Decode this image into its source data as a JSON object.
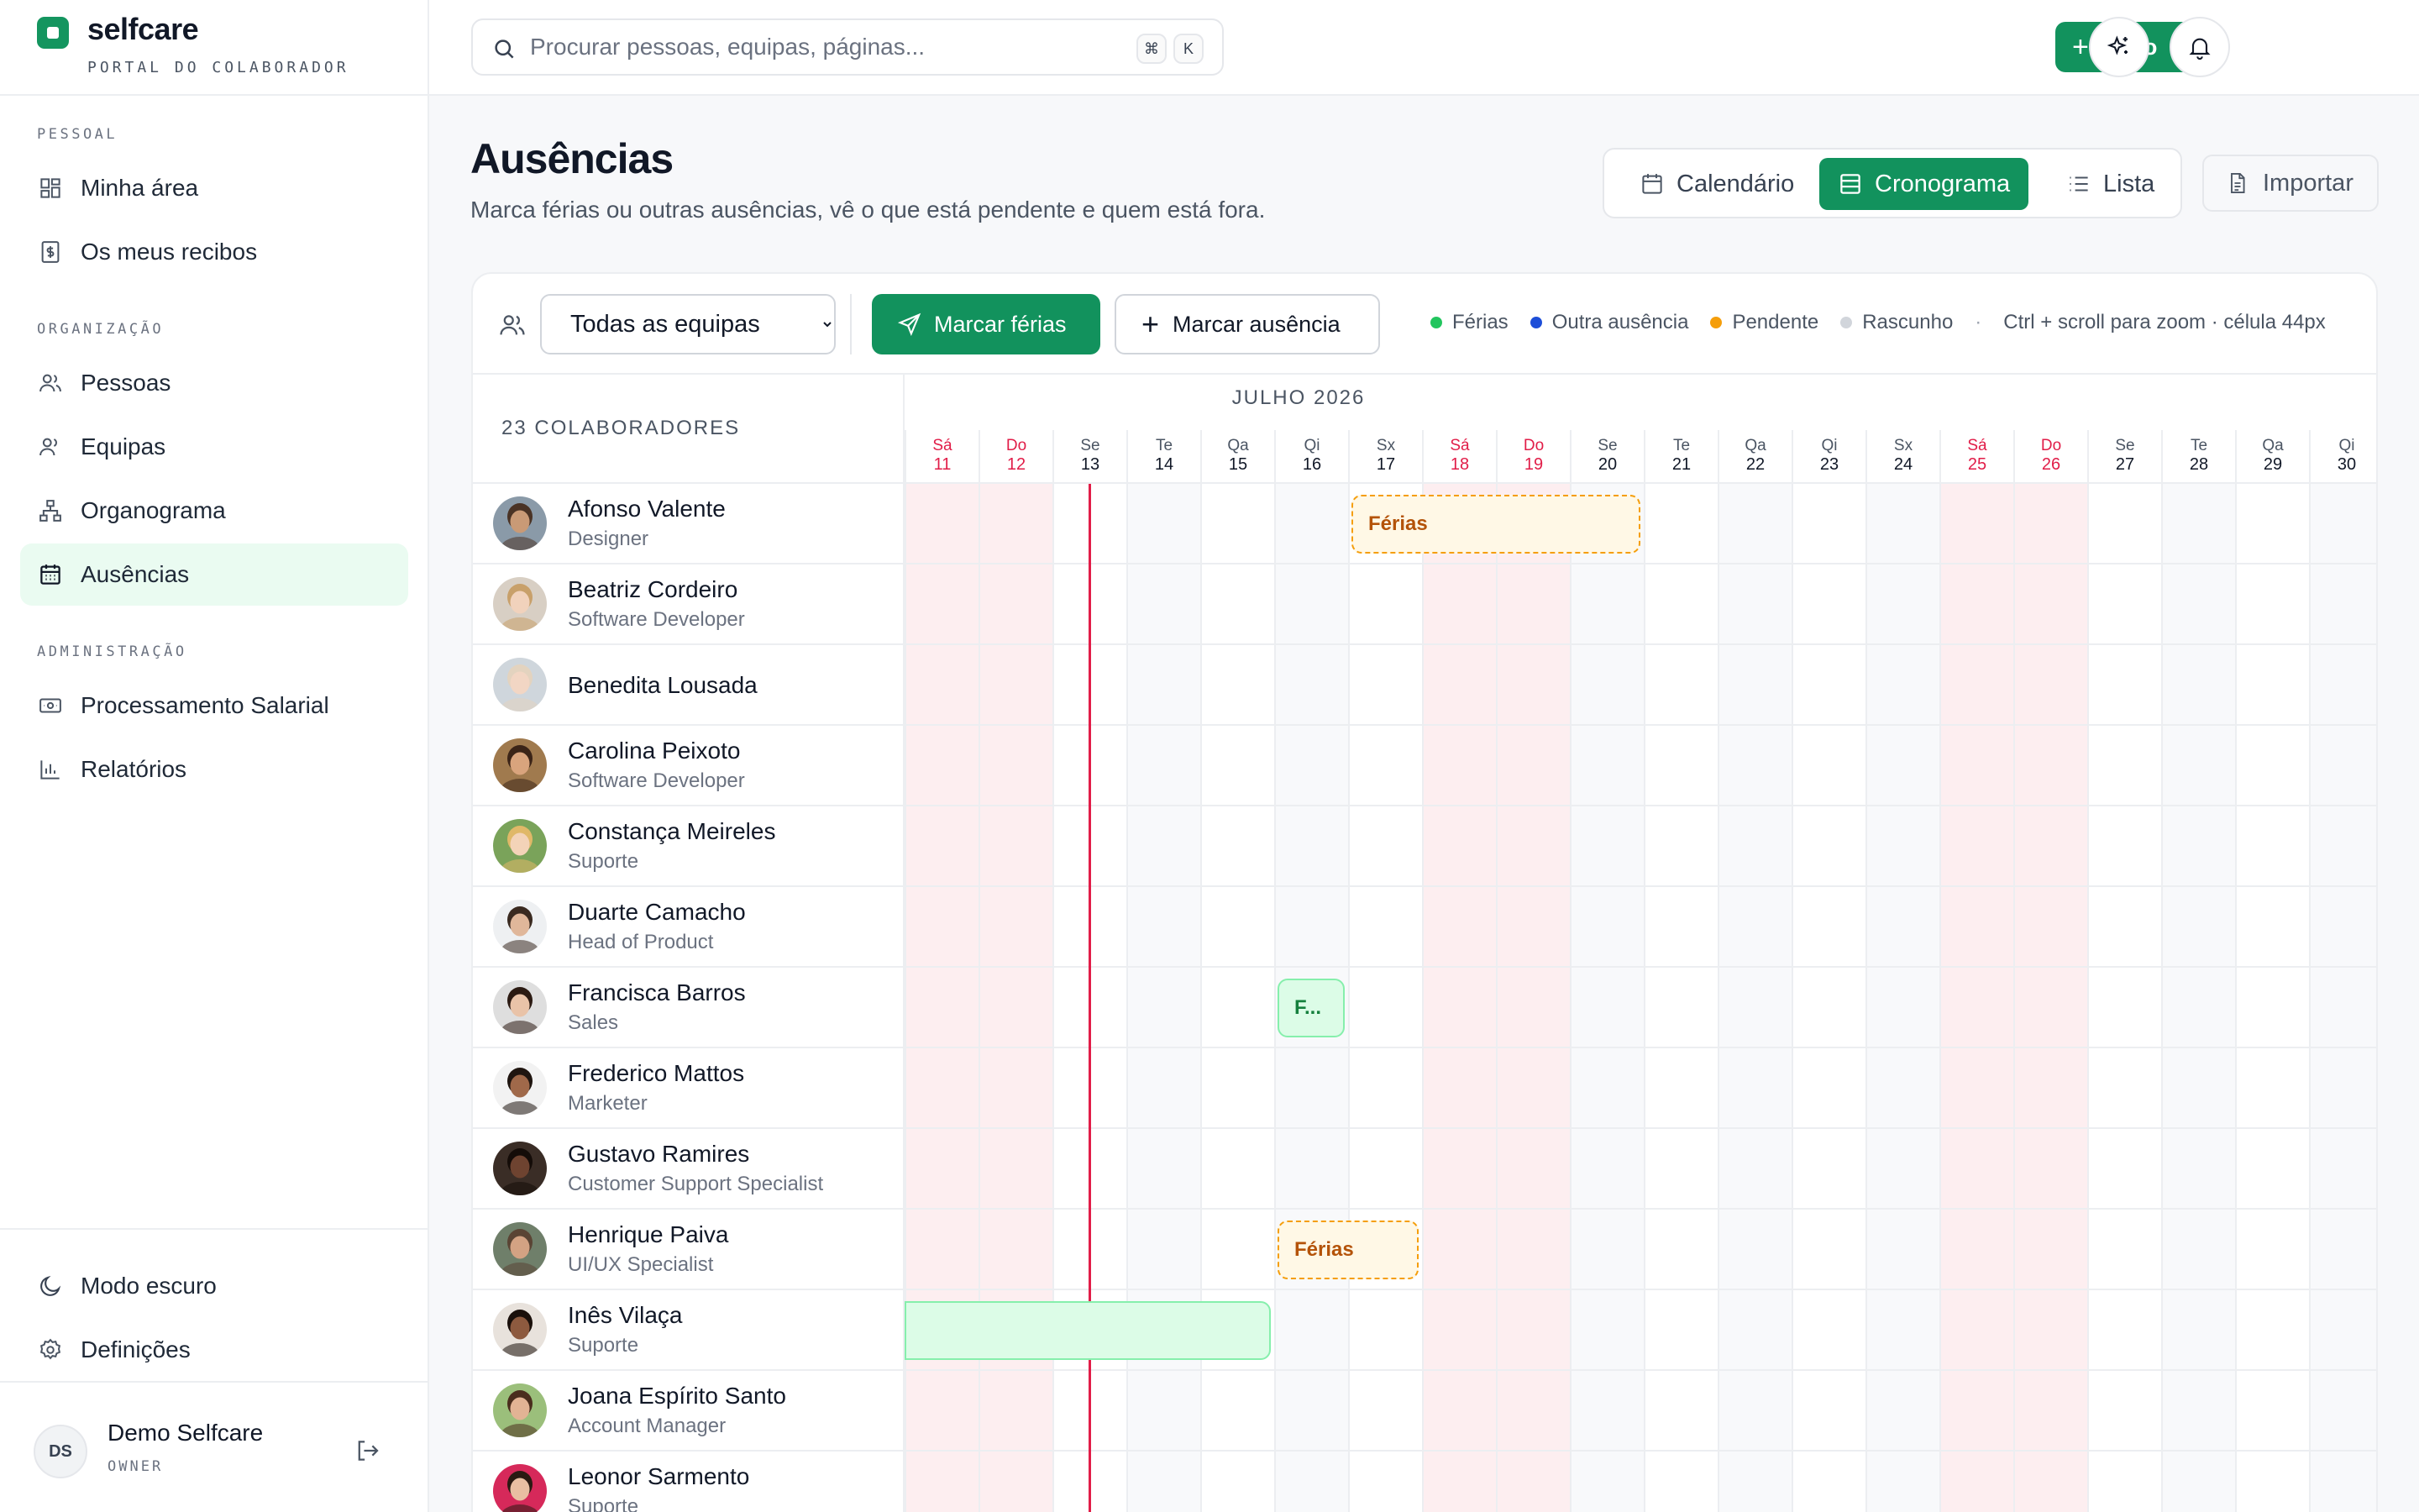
{
  "brand": {
    "name": "selfcare",
    "subtitle": "PORTAL DO COLABORADOR"
  },
  "sidebar": {
    "sections": [
      {
        "label": "PESSOAL",
        "items": [
          {
            "label": "Minha área",
            "icon": "grid-icon"
          },
          {
            "label": "Os meus recibos",
            "icon": "receipt-icon"
          }
        ]
      },
      {
        "label": "ORGANIZAÇÃO",
        "items": [
          {
            "label": "Pessoas",
            "icon": "people-icon"
          },
          {
            "label": "Equipas",
            "icon": "team-icon"
          },
          {
            "label": "Organograma",
            "icon": "org-chart-icon"
          },
          {
            "label": "Ausências",
            "icon": "calendar-icon",
            "active": true
          }
        ]
      },
      {
        "label": "ADMINISTRAÇÃO",
        "items": [
          {
            "label": "Processamento Salarial",
            "icon": "payroll-icon"
          },
          {
            "label": "Relatórios",
            "icon": "bar-chart-icon"
          }
        ]
      }
    ],
    "bottom": [
      {
        "label": "Modo escuro",
        "icon": "moon-icon"
      },
      {
        "label": "Definições",
        "icon": "gear-icon"
      }
    ],
    "user": {
      "initials": "DS",
      "name": "Demo Selfcare",
      "role": "OWNER"
    }
  },
  "topbar": {
    "search_placeholder": "Procurar pessoas, equipas, páginas...",
    "shortcut_keys": [
      "⌘",
      "K"
    ],
    "new_label": "Novo",
    "new_plus": "+",
    "new_mini": "+"
  },
  "page": {
    "title": "Ausências",
    "subtitle": "Marca férias ou outras ausências, vê o que está pendente e quem está fora."
  },
  "views": [
    {
      "label": "Calendário",
      "active": false
    },
    {
      "label": "Cronograma",
      "active": true
    },
    {
      "label": "Lista",
      "active": false
    }
  ],
  "import_label": "Importar",
  "toolbar": {
    "team_filter": {
      "selected": "Todas as equipas",
      "options": [
        "Todas as equipas"
      ]
    },
    "mark_vacation_label": "Marcar férias",
    "mark_absence_label": "Marcar ausência",
    "mark_absence_plus": "+",
    "legend": [
      {
        "label": "Férias",
        "color": "#22c55e"
      },
      {
        "label": "Outra ausência",
        "color": "#1d4ed8"
      },
      {
        "label": "Pendente",
        "color": "#f59e0b"
      },
      {
        "label": "Rascunho",
        "color": "#d1d5db"
      }
    ],
    "legend_sep": "·",
    "zoom_hint": "Ctrl + scroll para zoom · célula 44px"
  },
  "grid": {
    "people_count_label": "23 COLABORADORES",
    "month_label": "JULHO 2026",
    "today_index": 2,
    "days": [
      {
        "wd": "Sá",
        "dn": "11",
        "weekend": true
      },
      {
        "wd": "Do",
        "dn": "12",
        "weekend": true
      },
      {
        "wd": "Se",
        "dn": "13",
        "weekend": false
      },
      {
        "wd": "Te",
        "dn": "14",
        "weekend": false
      },
      {
        "wd": "Qa",
        "dn": "15",
        "weekend": false
      },
      {
        "wd": "Qi",
        "dn": "16",
        "weekend": false
      },
      {
        "wd": "Sx",
        "dn": "17",
        "weekend": false
      },
      {
        "wd": "Sá",
        "dn": "18",
        "weekend": true
      },
      {
        "wd": "Do",
        "dn": "19",
        "weekend": true
      },
      {
        "wd": "Se",
        "dn": "20",
        "weekend": false
      },
      {
        "wd": "Te",
        "dn": "21",
        "weekend": false
      },
      {
        "wd": "Qa",
        "dn": "22",
        "weekend": false
      },
      {
        "wd": "Qi",
        "dn": "23",
        "weekend": false
      },
      {
        "wd": "Sx",
        "dn": "24",
        "weekend": false
      },
      {
        "wd": "Sá",
        "dn": "25",
        "weekend": true
      },
      {
        "wd": "Do",
        "dn": "26",
        "weekend": true
      },
      {
        "wd": "Se",
        "dn": "27",
        "weekend": false
      },
      {
        "wd": "Te",
        "dn": "28",
        "weekend": false
      },
      {
        "wd": "Qa",
        "dn": "29",
        "weekend": false
      },
      {
        "wd": "Qi",
        "dn": "30",
        "weekend": false
      }
    ],
    "people": [
      {
        "name": "Afonso Valente",
        "role": "Designer",
        "skin": "#c99a76",
        "hair": "#4a3325",
        "bg": "#8a9aa8"
      },
      {
        "name": "Beatriz Cordeiro",
        "role": "Software Developer",
        "skin": "#f1d2bc",
        "hair": "#c8a06a",
        "bg": "#d8cfc4"
      },
      {
        "name": "Benedita Lousada",
        "role": "",
        "skin": "#f2d6c4",
        "hair": "#e3d3bf",
        "bg": "#cfd6dc"
      },
      {
        "name": "Carolina Peixoto",
        "role": "Software Developer",
        "skin": "#d9a47d",
        "hair": "#3b2417",
        "bg": "#a07a4e"
      },
      {
        "name": "Constança Meireles",
        "role": "Suporte",
        "skin": "#f3d3b8",
        "hair": "#e0b868",
        "bg": "#7aa35a"
      },
      {
        "name": "Duarte Camacho",
        "role": "Head of Product",
        "skin": "#e0b79a",
        "hair": "#3a2a20",
        "bg": "#eef0f2"
      },
      {
        "name": "Francisca Barros",
        "role": "Sales",
        "skin": "#e9c3a8",
        "hair": "#2b1a12",
        "bg": "#dedede"
      },
      {
        "name": "Frederico Mattos",
        "role": "Marketer",
        "skin": "#a0694a",
        "hair": "#1f1510",
        "bg": "#f2f2f2"
      },
      {
        "name": "Gustavo Ramires",
        "role": "Customer Support Specialist",
        "skin": "#6e4330",
        "hair": "#140c08",
        "bg": "#3a2d26"
      },
      {
        "name": "Henrique Paiva",
        "role": "UI/UX Specialist",
        "skin": "#d3a283",
        "hair": "#5a4434",
        "bg": "#6f7f6a"
      },
      {
        "name": "Inês Vilaça",
        "role": "Suporte",
        "skin": "#8d5a3f",
        "hair": "#1a100b",
        "bg": "#e8e2dc"
      },
      {
        "name": "Joana Espírito Santo",
        "role": "Account Manager",
        "skin": "#e2b394",
        "hair": "#4a2d1d",
        "bg": "#9bbf7b"
      },
      {
        "name": "Leonor Sarmento",
        "role": "Suporte",
        "skin": "#e9bfa2",
        "hair": "#2a1a12",
        "bg": "#d6295a"
      }
    ],
    "absences": [
      {
        "person": 0,
        "start": 6,
        "end": 9,
        "status": "pending",
        "label": "Férias"
      },
      {
        "person": 6,
        "start": 5,
        "end": 5,
        "status": "vacation",
        "label": "F..."
      },
      {
        "person": 9,
        "start": 5,
        "end": 6,
        "status": "pending",
        "label": "Férias"
      },
      {
        "person": 10,
        "start": 0,
        "end": 4,
        "status": "vacation",
        "label": ""
      }
    ]
  }
}
